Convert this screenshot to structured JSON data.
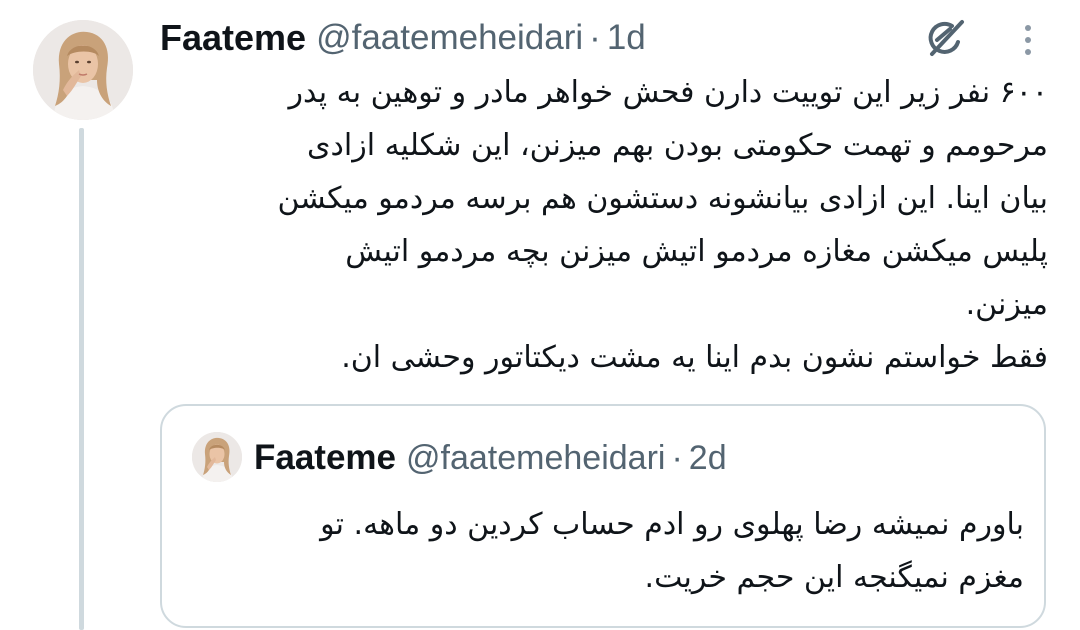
{
  "tweet": {
    "avatar_icon": "profile-photo",
    "display_name": "Faateme",
    "handle": "@faatemeheidari",
    "separator": "·",
    "time": "1d",
    "grok_icon": "grok-icon",
    "more_icon": "more-vertical-icon",
    "text_lines": [
      "۶۰۰ نفر زیر این توییت دارن فحش خواهر مادر و توهین به پدر",
      "مرحومم و تهمت حکومتی بودن بهم میزنن، این شکلیه ازادی",
      "بیان اینا. این ازادی بیانشونه دستشون هم برسه مردمو میکشن",
      "پلیس میکشن مغازه مردمو اتیش میزنن بچه مردمو اتیش",
      "میزنن.",
      "فقط خواستم نشون بدم اینا یه مشت دیکتاتور وحشی ان."
    ]
  },
  "quote": {
    "avatar_icon": "profile-photo",
    "display_name": "Faateme",
    "handle": "@faatemeheidari",
    "separator": "·",
    "time": "2d",
    "text_lines": [
      "باورم نمیشه رضا پهلوی رو ادم حساب کردین دو ماهه. تو",
      "مغزم نمیگنجه این حجم خریت."
    ]
  },
  "colors": {
    "text_primary": "#0f1419",
    "text_secondary": "#536471",
    "border": "#cfd9de"
  }
}
